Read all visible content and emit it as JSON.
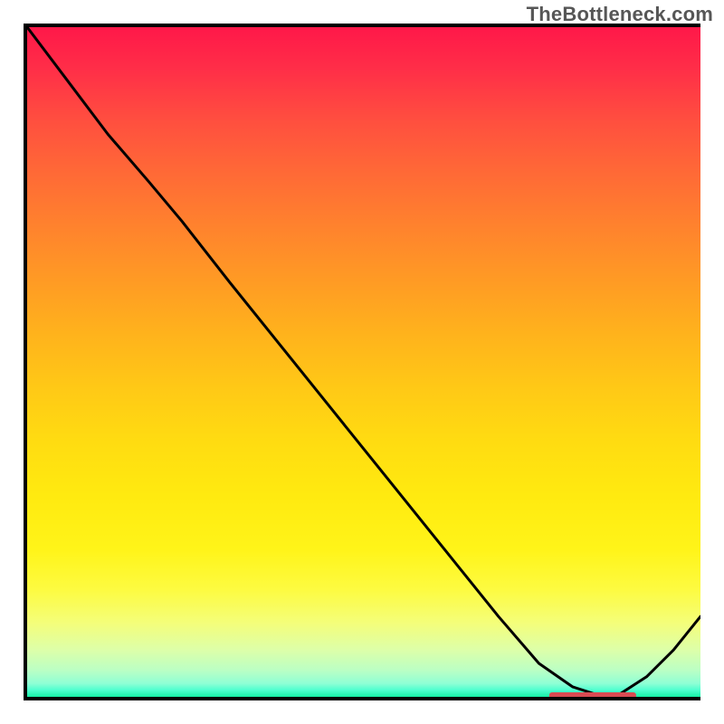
{
  "watermark": "TheBottleneck.com",
  "chart_data": {
    "type": "line",
    "title": "",
    "xlabel": "",
    "ylabel": "",
    "x": [
      0.0,
      0.06,
      0.12,
      0.18,
      0.23,
      0.3,
      0.38,
      0.46,
      0.54,
      0.62,
      0.7,
      0.76,
      0.81,
      0.85,
      0.88,
      0.92,
      0.96,
      1.0
    ],
    "values": [
      100.0,
      92.0,
      84.0,
      77.0,
      71.0,
      62.0,
      52.0,
      42.0,
      32.0,
      22.0,
      12.0,
      5.0,
      1.5,
      0.2,
      0.4,
      3.0,
      7.0,
      12.0
    ],
    "ylim": [
      0,
      100
    ],
    "xlim": [
      0,
      1
    ],
    "optimal_range_x": [
      0.78,
      0.91
    ],
    "optimal_y": 0.0,
    "background": "heat-gradient-red-to-green",
    "colors": {
      "curve": "#000000",
      "marker": "#d94a52",
      "gradient_top": "#ff1849",
      "gradient_bottom": "#15f0a6"
    }
  }
}
